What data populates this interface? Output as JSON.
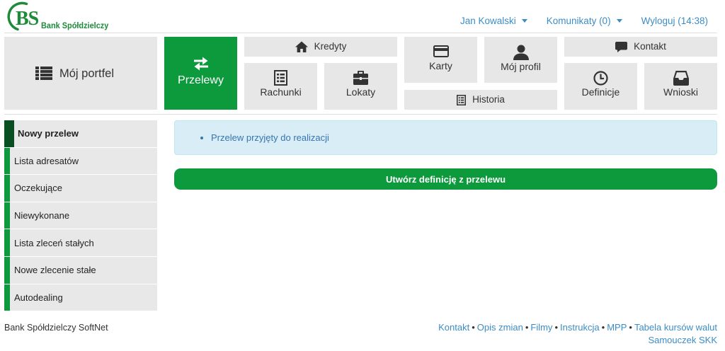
{
  "logo": {
    "mark": "BS",
    "name": "Bank Spółdzielczy"
  },
  "header": {
    "user_menu": "Jan Kowalski",
    "messages_menu": "Komunikaty (0)",
    "logout": "Wyloguj (14:38)"
  },
  "nav": {
    "tiles": [
      {
        "label": "Mój portfel",
        "icon": "list-icon",
        "active": false
      },
      {
        "label": "Przelewy",
        "icon": "transfer-icon",
        "active": true
      },
      {
        "label": "Kredyty",
        "icon": "home-icon",
        "active": false
      },
      {
        "label": "Rachunki",
        "icon": "list-alt-icon",
        "active": false
      },
      {
        "label": "Lokaty",
        "icon": "briefcase-icon",
        "active": false
      },
      {
        "label": "Karty",
        "icon": "credit-card-icon",
        "active": false
      },
      {
        "label": "Mój profil",
        "icon": "user-icon",
        "active": false
      },
      {
        "label": "Historia",
        "icon": "list-alt-icon",
        "active": false
      },
      {
        "label": "Kontakt",
        "icon": "comment-icon",
        "active": false
      },
      {
        "label": "Definicje",
        "icon": "clock-icon",
        "active": false
      },
      {
        "label": "Wnioski",
        "icon": "inbox-icon",
        "active": false
      }
    ]
  },
  "sidebar": {
    "items": [
      {
        "label": "Nowy przelew",
        "active": true
      },
      {
        "label": "Lista adresatów",
        "active": false
      },
      {
        "label": "Oczekujące",
        "active": false
      },
      {
        "label": "Niewykonane",
        "active": false
      },
      {
        "label": "Lista zleceń stałych",
        "active": false
      },
      {
        "label": "Nowe zlecenie stałe",
        "active": false
      },
      {
        "label": "Autodealing",
        "active": false
      }
    ]
  },
  "main": {
    "alert": {
      "messages": [
        "Przelew przyjęty do realizacji"
      ]
    },
    "create_definition_button": "Utwórz definicję z przelewu"
  },
  "footer": {
    "brand": "Bank Spółdzielczy SoftNet",
    "separator": "•",
    "links": [
      "Kontakt",
      "Opis zmian",
      "Filmy",
      "Instrukcja",
      "MPP",
      "Tabela kursów walut",
      "Samouczek SKK"
    ]
  },
  "colors": {
    "brand_green": "#0c9a3c",
    "active_marker": "#0a4f21",
    "link_blue": "#3c8dc5",
    "tile_gray": "#e7e7e7",
    "alert_bg": "#d9edf7",
    "alert_text": "#3575b0",
    "logo_green": "#1d8b3a"
  }
}
